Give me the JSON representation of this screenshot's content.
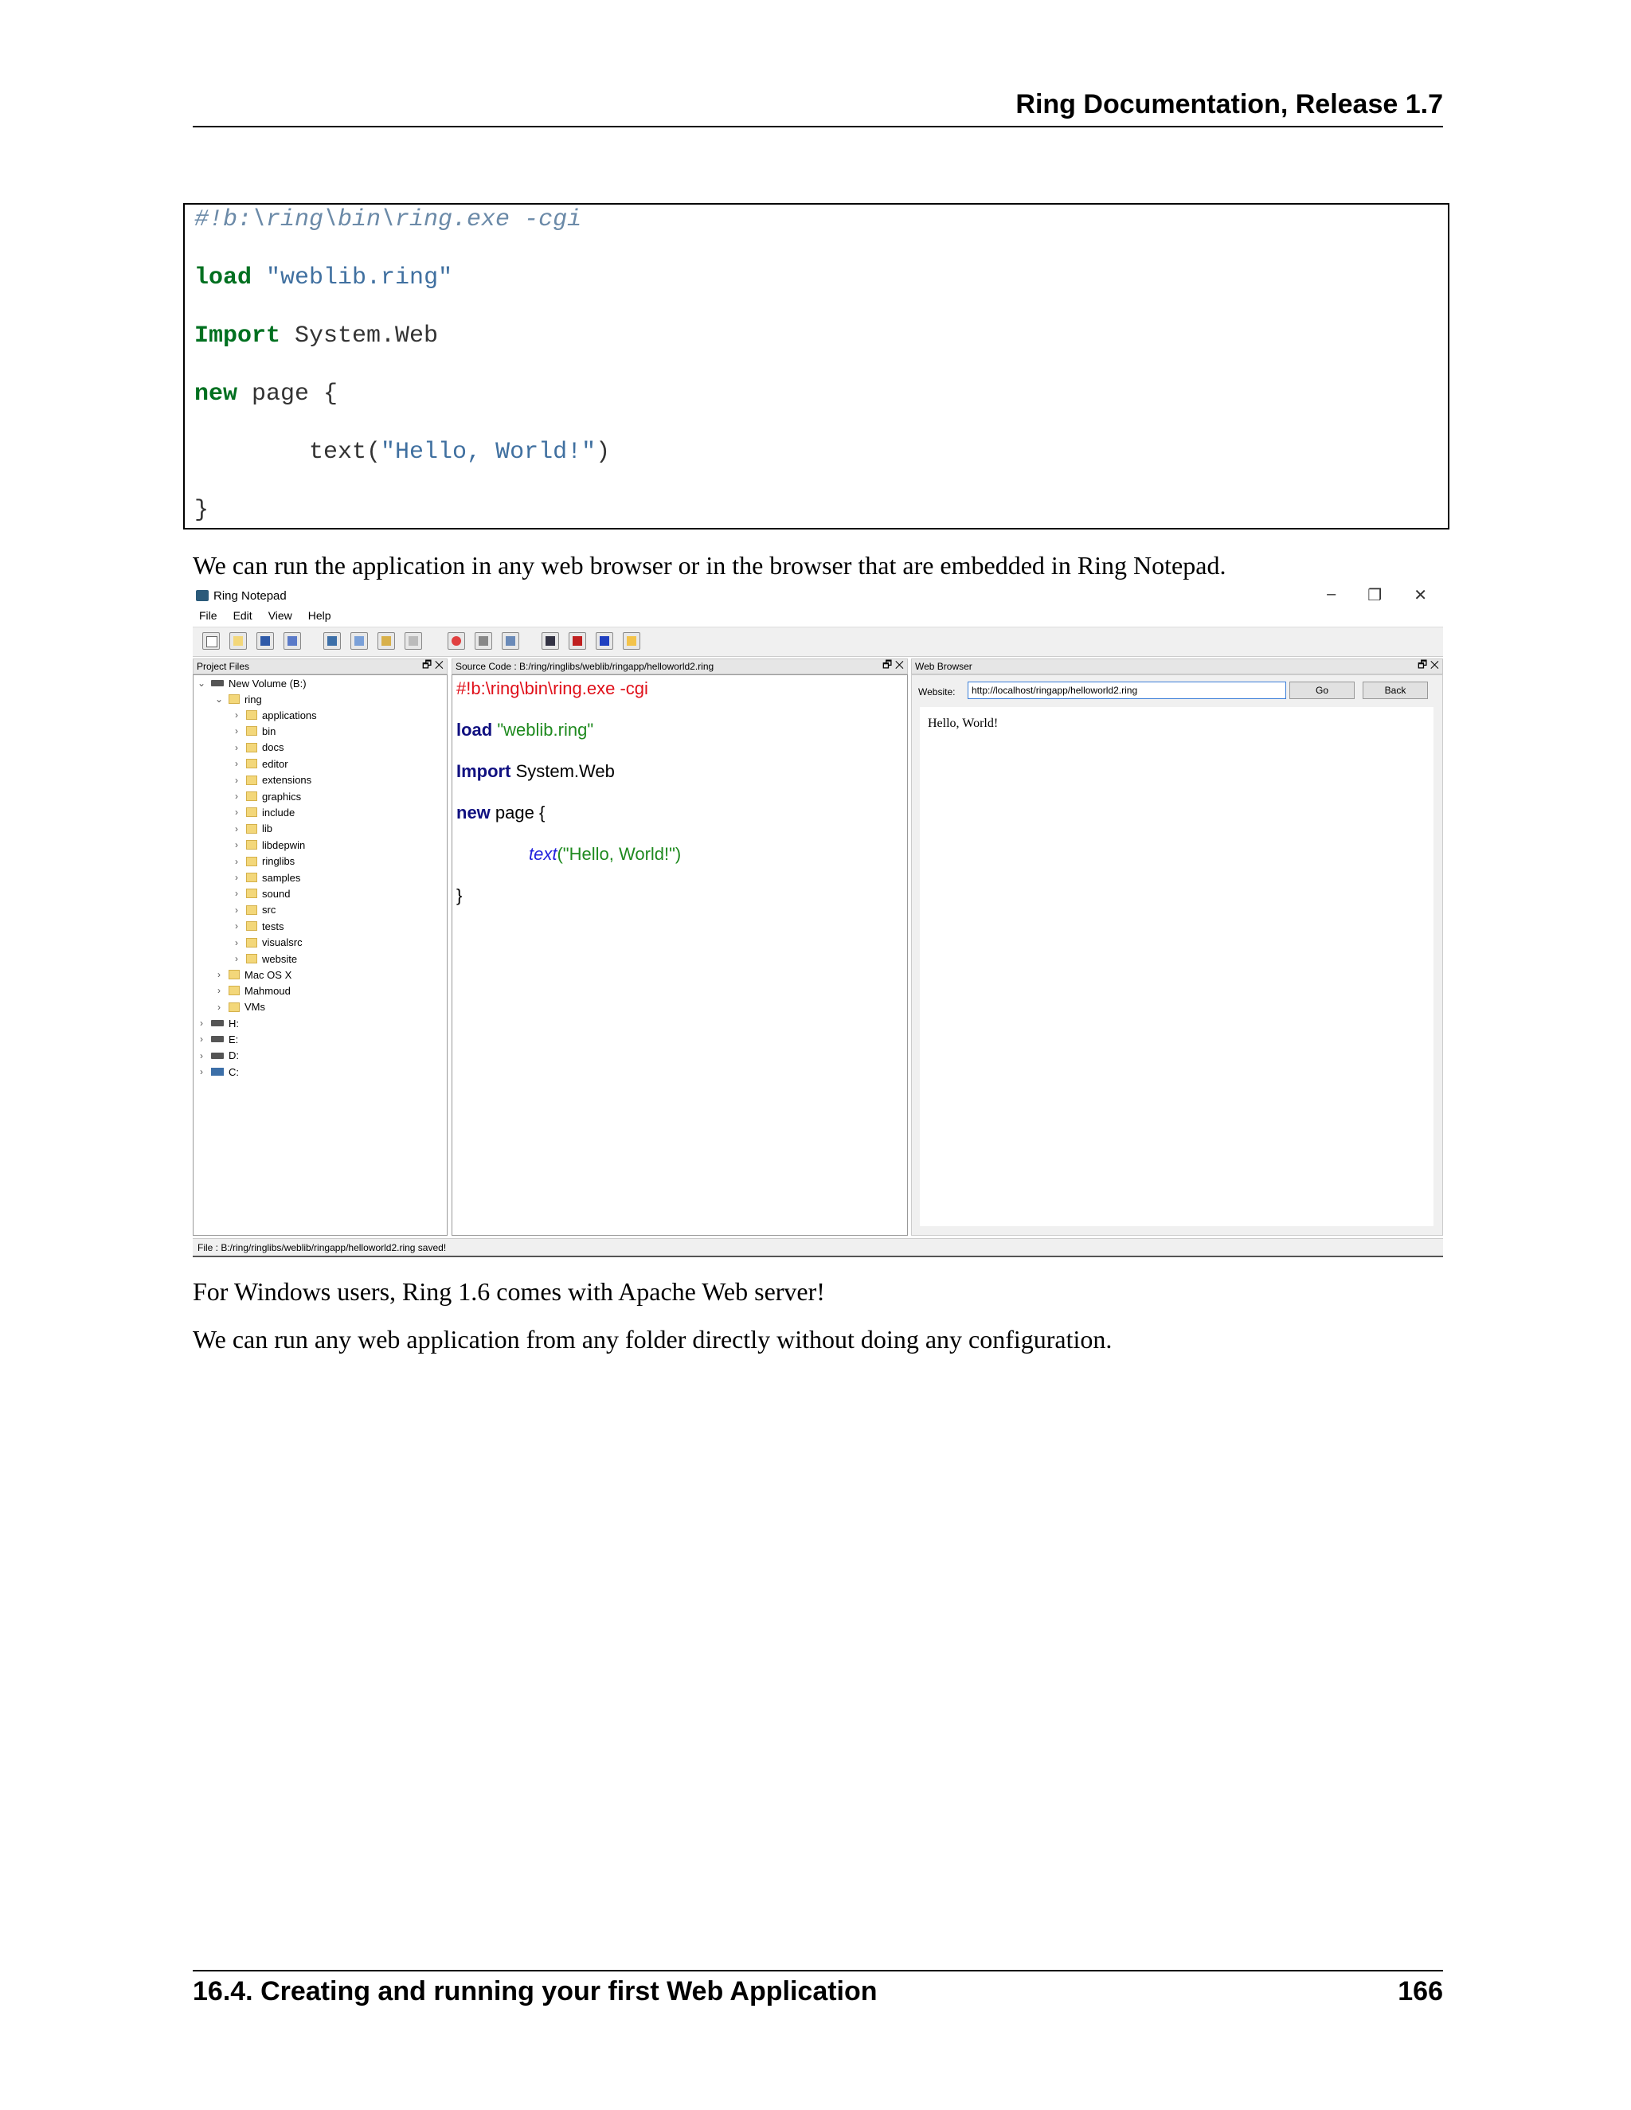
{
  "header": {
    "title": "Ring Documentation, Release 1.7"
  },
  "code": {
    "line1": "#!b:\\ring\\bin\\ring.exe -cgi",
    "load_kw": "load",
    "load_str": "\"weblib.ring\"",
    "import_kw": "Import",
    "import_rest": " System.Web",
    "new_kw": "new",
    "new_rest": " page {",
    "text_pre": "        text(",
    "text_str": "\"Hello, World!\"",
    "text_post": ")",
    "close": "}"
  },
  "para1": "We can run the application in any web browser or in the browser that are embedded in Ring Notepad.",
  "screenshot": {
    "window_title": "Ring Notepad",
    "menu": [
      "File",
      "Edit",
      "View",
      "Help"
    ],
    "panels": {
      "project": "Project Files",
      "source": "Source Code : B:/ring/ringlibs/weblib/ringapp/helloworld2.ring",
      "browser": "Web Browser",
      "controls": "🗗 ✕"
    },
    "tree": {
      "volume": "New Volume (B:)",
      "ring": "ring",
      "folders": [
        "applications",
        "bin",
        "docs",
        "editor",
        "extensions",
        "graphics",
        "include",
        "lib",
        "libdepwin",
        "ringlibs",
        "samples",
        "sound",
        "src",
        "tests",
        "visualsrc",
        "website"
      ],
      "siblings": [
        "Mac OS X",
        "Mahmoud",
        "VMs"
      ],
      "drives": [
        "H:",
        "E:",
        "D:",
        "C:"
      ]
    },
    "editor": {
      "line1": "#!b:\\ring\\bin\\ring.exe -cgi",
      "load_kw": "load",
      "load_str": " \"weblib.ring\"",
      "import_kw": "Import",
      "import_rest": " System.Web",
      "new_kw": "new",
      "new_rest": " page {",
      "text_fn": "text",
      "text_str": "(\"Hello, World!\")",
      "close": "}"
    },
    "browser": {
      "label": "Website:",
      "url": "http://localhost/ringapp/helloworld2.ring",
      "go": "Go",
      "back": "Back",
      "content": "Hello, World!"
    },
    "status": "File : B:/ring/ringlibs/weblib/ringapp/helloworld2.ring saved!"
  },
  "para2": "For Windows users, Ring 1.6 comes with Apache Web server!",
  "para3": "We can run any web application from any folder directly without doing any configuration.",
  "footer": {
    "section": "16.4.  Creating and running your first Web Application",
    "page": "166"
  }
}
